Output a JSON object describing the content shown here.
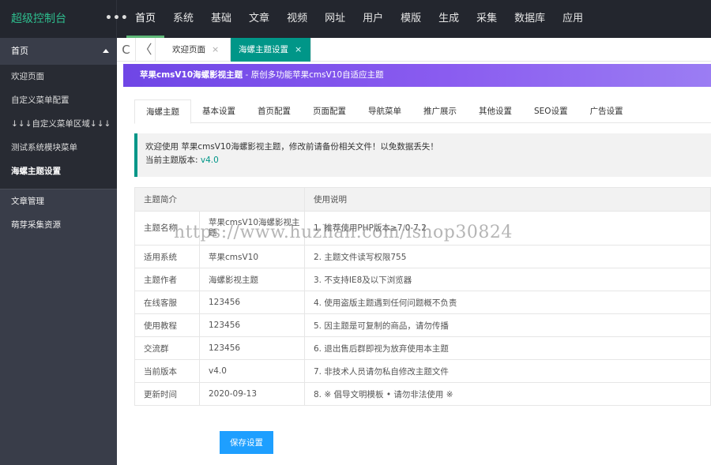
{
  "brand": "超级控制台",
  "more": "•••",
  "topnav": [
    "首页",
    "系统",
    "基础",
    "文章",
    "视频",
    "网址",
    "用户",
    "模版",
    "生成",
    "采集",
    "数据库",
    "应用"
  ],
  "sidebar": {
    "head": "首页",
    "items": [
      "欢迎页面",
      "自定义菜单配置",
      "↓↓↓自定义菜单区域↓↓↓",
      "测试系统模块菜单",
      "海螺主题设置"
    ],
    "lower": [
      "文章管理",
      "萌芽采集资源"
    ]
  },
  "tabs": {
    "refresh": "C",
    "prev": "〈",
    "welcome": "欢迎页面",
    "theme": "海螺主题设置",
    "close": "×"
  },
  "banner": {
    "title": "苹果cmsV10海螺影视主题",
    "sub": " - 原创多功能苹果cmsV10自适应主题"
  },
  "subtabs": [
    "海螺主题",
    "基本设置",
    "首页配置",
    "页面配置",
    "导航菜单",
    "推广展示",
    "其他设置",
    "SEO设置",
    "广告设置"
  ],
  "notice": {
    "line1": "欢迎使用 苹果cmsV10海螺影视主题，修改前请备份相关文件！以免数据丢失！",
    "line2_label": "当前主题版本: ",
    "version": "v4.0"
  },
  "table": {
    "head1": "主题简介",
    "head2": "使用说明",
    "rows": [
      {
        "k": "主题名称",
        "v": "苹果cmsV10海螺影视主题",
        "n": "1. 推荐使用PHP版本≥7.0-7.2"
      },
      {
        "k": "适用系统",
        "v": "苹果cmsV10",
        "n": "2. 主题文件读写权限755"
      },
      {
        "k": "主题作者",
        "v": "海螺影视主题",
        "n": "3. 不支持IE8及以下浏览器"
      },
      {
        "k": "在线客服",
        "v": "123456",
        "n": "4. 使用盗版主题遇到任何问题概不负责"
      },
      {
        "k": "使用教程",
        "v": "123456",
        "n": "5. 因主题是可复制的商品，请勿传播"
      },
      {
        "k": "交流群",
        "v": "123456",
        "n": "6. 退出售后群即视为放弃使用本主题"
      },
      {
        "k": "当前版本",
        "v": "v4.0",
        "n": "7. 非技术人员请勿私自修改主题文件"
      },
      {
        "k": "更新时间",
        "v": "2020-09-13",
        "n": "8. ※ 倡导文明模板 • 请勿非法使用 ※"
      }
    ]
  },
  "save": "保存设置",
  "watermark": "https://www.huzhan.com/ishop30824"
}
